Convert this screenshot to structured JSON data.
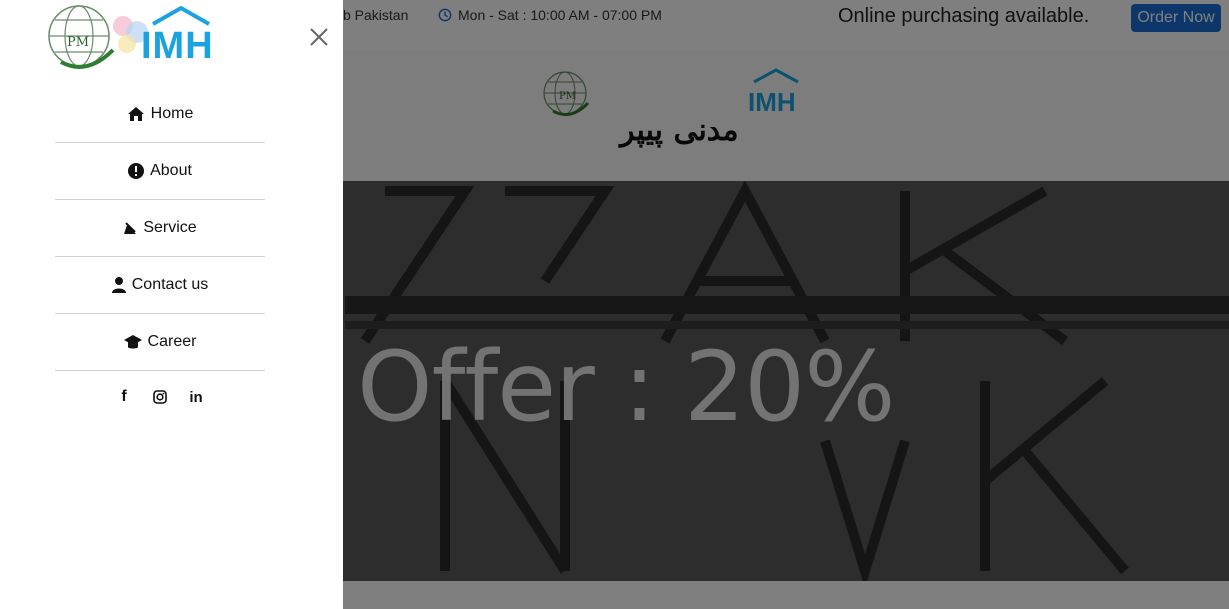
{
  "topbar": {
    "address_fragment": "b Pakistan",
    "hours": "Mon - Sat : 10:00 AM - 07:00 PM",
    "online_text": "Online purchasing available.",
    "order_button": "Order Now"
  },
  "header": {
    "urdu_title": "مدنی پیپر",
    "brand": "IMH"
  },
  "hero": {
    "offer_text": "Offer : 20%"
  },
  "drawer": {
    "brand": "IMH",
    "menu": [
      {
        "label": "Home",
        "icon": "home-icon"
      },
      {
        "label": "About",
        "icon": "info-icon"
      },
      {
        "label": "Service",
        "icon": "service-icon"
      },
      {
        "label": "Contact us",
        "icon": "user-icon"
      },
      {
        "label": "Career",
        "icon": "graduation-cap-icon"
      }
    ],
    "social": [
      {
        "name": "facebook-icon",
        "glyph": "f"
      },
      {
        "name": "instagram-icon",
        "glyph": "◎"
      },
      {
        "name": "linkedin-icon",
        "glyph": "in"
      }
    ]
  },
  "colors": {
    "brand_blue": "#1a6fd6",
    "imh_cyan": "#1aa3e0",
    "logo_green": "#2e7d32"
  }
}
